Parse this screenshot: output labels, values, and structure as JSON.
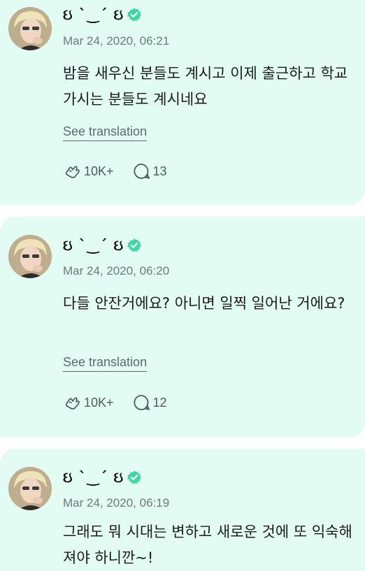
{
  "posts": [
    {
      "author_name": "ઇ ˋ‿ˊ ઇ",
      "timestamp": "Mar 24, 2020, 06:21",
      "text": "밤을 새우신 분들도 계시고 이제 출근하고 학교 가시는 분들도 계시네요",
      "translate_label": "See translation",
      "likes": "10K+",
      "comments": "13"
    },
    {
      "author_name": "ઇ ˋ‿ˊ ઇ",
      "timestamp": "Mar 24, 2020, 06:20",
      "text": "다들 안잔거에요? 아니면 일찍 일어난 거에요?",
      "translate_label": "See translation",
      "likes": "10K+",
      "comments": "12"
    },
    {
      "author_name": "ઇ ˋ‿ˊ ઇ",
      "timestamp": "Mar 24, 2020, 06:19",
      "text": "그래도 뭐 시대는 변하고 새로운 것에 또 익숙해져야 하니깐~!"
    }
  ],
  "colors": {
    "card_background": "#e2fbf3",
    "verified_badge": "#3fd8a4",
    "text_primary": "#1a1a1a",
    "text_secondary": "#6c7a78"
  },
  "icons": {
    "avatar": "avatar-photo",
    "verified": "verified-badge-icon",
    "like": "reaction-heart-hand-icon",
    "comment": "comment-bubble-icon"
  }
}
